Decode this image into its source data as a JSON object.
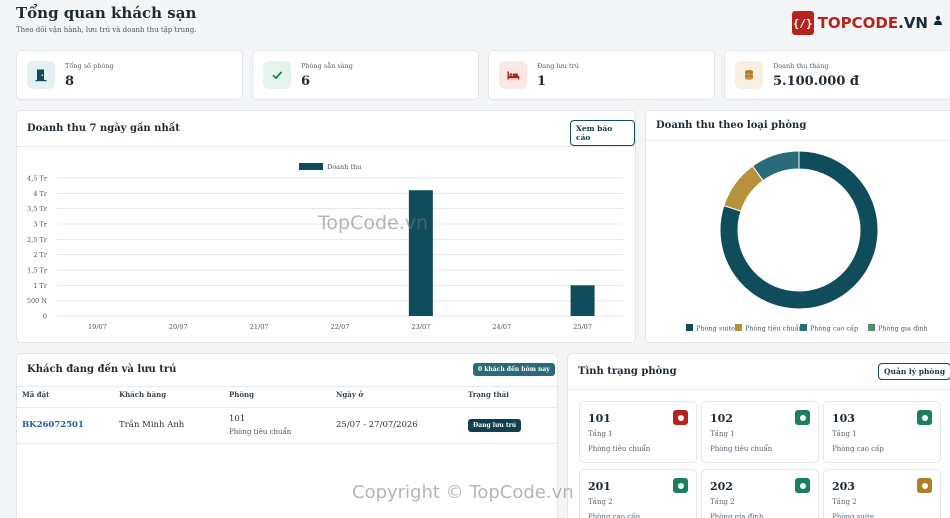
{
  "header": {
    "title": "Tổng quan khách sạn",
    "subtitle": "Theo dõi vận hành, lưu trú và doanh thu tập trung."
  },
  "logo": {
    "badge": "{/}",
    "text_main": "TOPCODE",
    "text_suffix": ".VN"
  },
  "kpis": [
    {
      "label": "Tổng số phòng",
      "value": "8",
      "icon": "door-icon",
      "color": "#0f4c5c"
    },
    {
      "label": "Phòng sẵn sàng",
      "value": "6",
      "icon": "check-icon",
      "color": "#1a7f5a"
    },
    {
      "label": "Đang lưu trú",
      "value": "1",
      "icon": "bed-icon",
      "color": "#b4241c"
    },
    {
      "label": "Doanh thu tháng",
      "value": "5.100.000 đ",
      "icon": "coins-icon",
      "color": "#b07d2a"
    }
  ],
  "revenue_panel": {
    "title": "Doanh thu 7 ngày gần nhất",
    "button": "Xem báo cáo"
  },
  "room_type_panel": {
    "title": "Doanh thu theo loại phòng"
  },
  "chart_data": [
    {
      "type": "bar",
      "categories": [
        "19/07",
        "20/07",
        "21/07",
        "22/07",
        "23/07",
        "24/07",
        "25/07"
      ],
      "series": [
        {
          "name": "Doanh thu",
          "values": [
            0,
            0,
            0,
            0,
            4100000,
            0,
            1000000
          ],
          "color": "#0f4c5c"
        }
      ],
      "ylim": [
        0,
        4500000
      ],
      "yticks": [
        0,
        500000,
        1000000,
        1500000,
        2000000,
        2500000,
        3000000,
        3500000,
        4000000,
        4500000
      ],
      "ytick_labels": [
        "0",
        "500 N",
        "1 Tr",
        "1,5 Tr",
        "2 Tr",
        "2,5 Tr",
        "3 Tr",
        "3,5 Tr",
        "4 Tr",
        "4,5 Tr"
      ],
      "legend": "top-center",
      "grid": true
    },
    {
      "type": "pie",
      "donut": true,
      "labels": [
        "Phòng suite",
        "Phòng tiêu chuẩn",
        "Phòng cao cấp",
        "Phòng gia đình"
      ],
      "values": [
        80,
        10,
        10,
        0
      ],
      "colors": [
        "#0f4c5c",
        "#b8913b",
        "#2a6b7a",
        "#5b8a6e"
      ],
      "legend": "bottom"
    }
  ],
  "arrivals_panel": {
    "title": "Khách đang đến và lưu trú",
    "badge": "0 khách đến hôm nay",
    "columns": [
      "Mã đặt",
      "Khách hàng",
      "Phòng",
      "Ngày ở",
      "Trạng thái"
    ],
    "rows": [
      {
        "code": "BK26072501",
        "customer": "Trần Minh Anh",
        "room": "101",
        "room_type": "Phòng tiêu chuẩn",
        "dates": "25/07 - 27/07/2026",
        "status": "Đang lưu trú"
      }
    ]
  },
  "rooms_panel": {
    "title": "Tình trạng phòng",
    "button": "Quản lý phòng",
    "rooms": [
      {
        "number": "101",
        "floor": "Tầng 1",
        "type": "Phòng tiêu chuẩn",
        "status_color": "#b4241c"
      },
      {
        "number": "102",
        "floor": "Tầng 1",
        "type": "Phòng tiêu chuẩn",
        "status_color": "#1a7f5a"
      },
      {
        "number": "103",
        "floor": "Tầng 1",
        "type": "Phòng cao cấp",
        "status_color": "#1a7f5a"
      },
      {
        "number": "201",
        "floor": "Tầng 2",
        "type": "Phòng cao cấp",
        "status_color": "#1a7f5a"
      },
      {
        "number": "202",
        "floor": "Tầng 2",
        "type": "Phòng gia đình",
        "status_color": "#1a7f5a"
      },
      {
        "number": "203",
        "floor": "Tầng 2",
        "type": "Phòng suite",
        "status_color": "#b07d2a"
      }
    ]
  },
  "watermarks": {
    "center": "TopCode.vn",
    "bottom": "Copyright © TopCode.vn"
  }
}
